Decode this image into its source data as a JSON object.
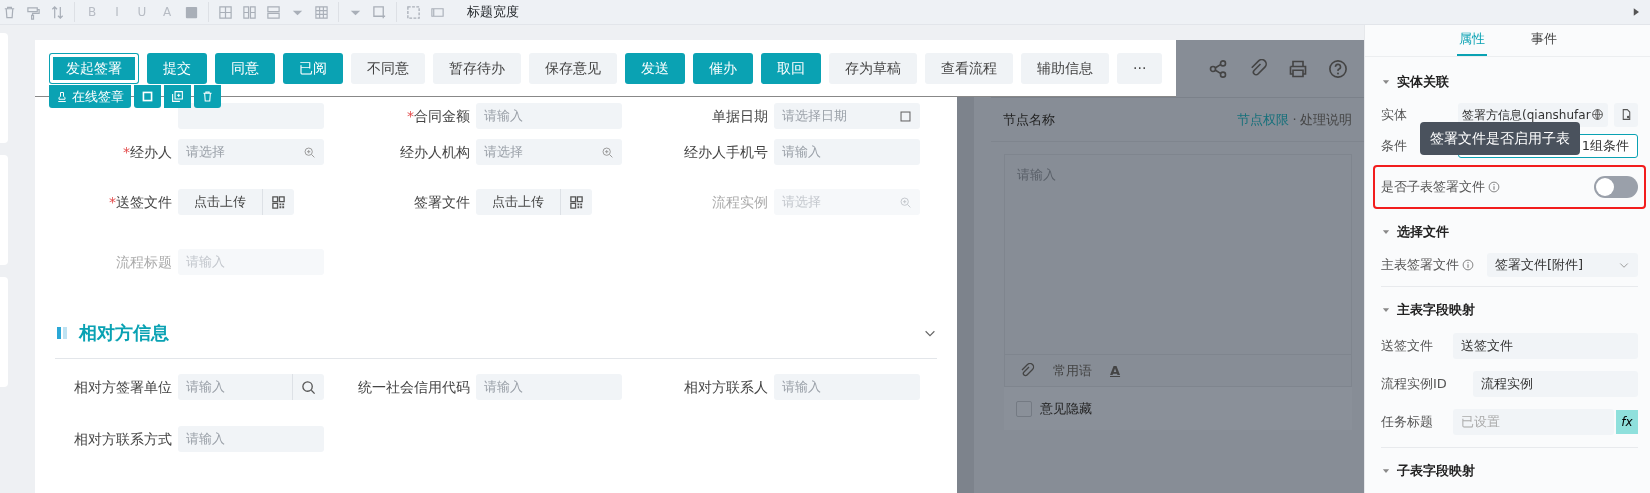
{
  "toolbar": {
    "items": [
      {
        "kind": "icon"
      },
      {
        "kind": "icon"
      },
      {
        "kind": "icon"
      },
      {
        "kind": "sep"
      },
      {
        "kind": "letter",
        "text": "B"
      },
      {
        "kind": "letter",
        "text": "I"
      },
      {
        "kind": "letter",
        "text": "U"
      },
      {
        "kind": "letter",
        "text": "A"
      },
      {
        "kind": "icon"
      },
      {
        "kind": "sep"
      },
      {
        "kind": "icon"
      },
      {
        "kind": "icon"
      },
      {
        "kind": "icon"
      },
      {
        "kind": "icon"
      },
      {
        "kind": "icon"
      },
      {
        "kind": "sep"
      },
      {
        "kind": "icon"
      },
      {
        "kind": "icon"
      },
      {
        "kind": "sep"
      },
      {
        "kind": "icon"
      },
      {
        "kind": "icon"
      }
    ],
    "label": "标题宽度"
  },
  "action_bar": {
    "buttons": [
      {
        "label": "发起签署",
        "kind": "primary",
        "selected": true
      },
      {
        "label": "提交",
        "kind": "primary",
        "selected": false
      },
      {
        "label": "同意",
        "kind": "primary",
        "selected": false
      },
      {
        "label": "已阅",
        "kind": "primary",
        "selected": false
      },
      {
        "label": "不同意",
        "kind": "secondary",
        "selected": false
      },
      {
        "label": "暂存待办",
        "kind": "secondary",
        "selected": false
      },
      {
        "label": "保存意见",
        "kind": "secondary",
        "selected": false
      },
      {
        "label": "发送",
        "kind": "primary",
        "selected": false
      },
      {
        "label": "催办",
        "kind": "primary",
        "selected": false
      },
      {
        "label": "取回",
        "kind": "primary",
        "selected": false
      },
      {
        "label": "存为草稿",
        "kind": "secondary",
        "selected": false
      },
      {
        "label": "查看流程",
        "kind": "secondary",
        "selected": false
      },
      {
        "label": "辅助信息",
        "kind": "secondary",
        "selected": false
      },
      {
        "label": "···",
        "kind": "secondary",
        "selected": false
      }
    ],
    "selection_tools": {
      "label": "在线签章"
    }
  },
  "form": {
    "rows": [
      {
        "fields": [
          {
            "kind": "input"
          },
          {
            "kind": "input",
            "label": "合同金额",
            "required_mark": "*",
            "placeholder": "请输入",
            "disabled": false
          },
          {
            "kind": "date",
            "label": "单据日期",
            "placeholder": "请选择日期",
            "disabled": false
          }
        ]
      },
      {
        "fields": [
          {
            "kind": "select",
            "label": "经办人",
            "required_mark": "*",
            "placeholder": "请选择",
            "disabled": false
          },
          {
            "kind": "select",
            "label": "经办人机构",
            "placeholder": "请选择",
            "disabled": false
          },
          {
            "kind": "input",
            "label": "经办人手机号",
            "placeholder": "请输入",
            "disabled": false
          }
        ]
      },
      {
        "fields": [
          {
            "kind": "upload",
            "label": "送签文件",
            "required_mark": "*",
            "placeholder": "点击上传",
            "disabled": false
          },
          {
            "kind": "upload",
            "label": "签署文件",
            "placeholder": "点击上传",
            "disabled": false
          },
          {
            "kind": "select",
            "label": "流程实例",
            "placeholder": "请选择",
            "disabled": true
          }
        ]
      },
      {
        "fields": [
          {
            "kind": "input",
            "label": "流程标题",
            "placeholder": "请输入",
            "disabled": true
          }
        ]
      }
    ],
    "section": {
      "title": "相对方信息",
      "expanded": true
    },
    "section_rows": [
      {
        "fields": [
          {
            "kind": "search",
            "label": "相对方签署单位",
            "placeholder": "请输入",
            "disabled": false
          },
          {
            "kind": "input",
            "label": "统一社会信用代码",
            "placeholder": "请输入",
            "disabled": false
          },
          {
            "kind": "input",
            "label": "相对方联系人",
            "placeholder": "请输入",
            "disabled": false
          }
        ]
      },
      {
        "fields": [
          {
            "kind": "input",
            "label": "相对方联系方式",
            "placeholder": "请输入",
            "disabled": false
          }
        ]
      }
    ]
  },
  "opinion_panel": {
    "title": "节点名称",
    "link": "节点权限",
    "separator": "·",
    "note": "处理说明",
    "placeholder": "请输入",
    "phrases": "常用语",
    "font_key": "A",
    "hide_opinion": {
      "label": "意见隐藏",
      "checked": false
    }
  },
  "properties": {
    "tabs": [
      {
        "label": "属性",
        "selected": true
      },
      {
        "label": "事件",
        "selected": false
      }
    ],
    "entity_section": {
      "title": "实体关联",
      "expanded": true,
      "entity_label": "实体",
      "entity_value": "签署方信息(qianshufar",
      "condition_label": "条件",
      "condition_value": "1组条件",
      "tooltip": "签署文件是否启用子表",
      "subtable_label": "是否子表签署文件",
      "subtable_on": false
    },
    "file_section": {
      "title": "选择文件",
      "expanded": true,
      "label": "主表签署文件",
      "value": "签署文件[附件]"
    },
    "mapping_section": {
      "title": "主表字段映射",
      "expanded": true,
      "rows": [
        {
          "label": "送签文件",
          "value": "送签文件",
          "kind": "field"
        },
        {
          "label": "流程实例ID",
          "value": "流程实例",
          "kind": "field"
        },
        {
          "label": "任务标题",
          "placeholder": "已设置",
          "kind": "formula",
          "button": "fx"
        }
      ]
    },
    "sub_section": {
      "title": "子表字段映射",
      "expanded": true
    }
  }
}
